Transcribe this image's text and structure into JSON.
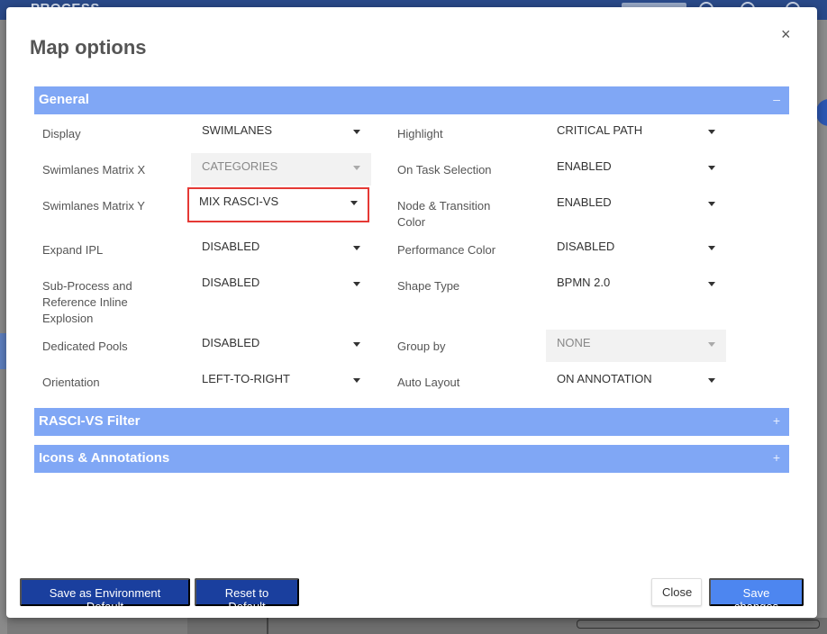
{
  "background": {
    "app_title": "PROCESS"
  },
  "modal": {
    "title": "Map options",
    "close_icon": "×"
  },
  "sections": {
    "general": {
      "label": "General",
      "toggle": "–"
    },
    "rasci_filter": {
      "label": "RASCI-VS Filter",
      "toggle": "+"
    },
    "icons_annotations": {
      "label": "Icons & Annotations",
      "toggle": "+"
    }
  },
  "general": {
    "left": [
      {
        "label": "Display",
        "value": "SWIMLANES",
        "disabled": false
      },
      {
        "label": "Swimlanes Matrix X",
        "value": "CATEGORIES",
        "disabled": true
      },
      {
        "label": "Swimlanes Matrix Y",
        "value": "MIX RASCI-VS",
        "disabled": false,
        "highlighted": true
      },
      {
        "label": "Expand IPL",
        "value": "DISABLED",
        "disabled": false
      },
      {
        "label": "Sub-Process and Reference Inline Explosion",
        "value": "DISABLED",
        "disabled": false
      },
      {
        "label": "Dedicated Pools",
        "value": "DISABLED",
        "disabled": false
      },
      {
        "label": "Orientation",
        "value": "LEFT-TO-RIGHT",
        "disabled": false
      }
    ],
    "right": [
      {
        "label": "Highlight",
        "value": "CRITICAL PATH",
        "disabled": false
      },
      {
        "label": "On Task Selection",
        "value": "ENABLED",
        "disabled": false
      },
      {
        "label": "Node & Transition Color",
        "value": "ENABLED",
        "disabled": false
      },
      {
        "label": "Performance Color",
        "value": "DISABLED",
        "disabled": false
      },
      {
        "label": "Shape Type",
        "value": "BPMN 2.0",
        "disabled": false
      },
      {
        "label": "Group by",
        "value": "NONE",
        "disabled": true
      },
      {
        "label": "Auto Layout",
        "value": "ON ANNOTATION",
        "disabled": false
      }
    ]
  },
  "footer": {
    "save_env_default": "Save as Environment Default",
    "reset_default": "Reset to Default",
    "close": "Close",
    "save_changes": "Save changes"
  },
  "colors": {
    "section_header": "#80a7f5",
    "primary_dark": "#1a3f9e",
    "primary": "#4d86f0",
    "highlight_border": "#e53935"
  }
}
